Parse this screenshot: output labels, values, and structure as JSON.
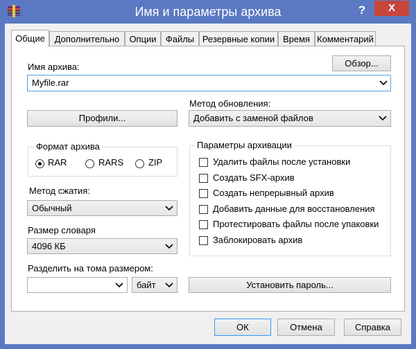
{
  "window": {
    "title": "Имя и параметры архива",
    "help_label": "?",
    "close_label": "X"
  },
  "tabs": [
    {
      "label": "Общие",
      "active": true
    },
    {
      "label": "Дополнительно"
    },
    {
      "label": "Опции"
    },
    {
      "label": "Файлы"
    },
    {
      "label": "Резервные копии"
    },
    {
      "label": "Время"
    },
    {
      "label": "Комментарий"
    }
  ],
  "general": {
    "archive_name_label": "Имя архива:",
    "browse_label": "Обзор...",
    "archive_name_value": "Myfile.rar",
    "profiles_label": "Профили...",
    "update_method_label": "Метод обновления:",
    "update_method_value": "Добавить с заменой файлов",
    "format_group_title": "Формат архива",
    "formats": [
      {
        "label": "RAR",
        "selected": true
      },
      {
        "label": "RARS",
        "selected": false
      },
      {
        "label": "ZIP",
        "selected": false
      }
    ],
    "compression_label": "Метод сжатия:",
    "compression_value": "Обычный",
    "dictionary_label": "Размер словаря",
    "dictionary_value": "4096 КБ",
    "split_label": "Разделить на тома размером:",
    "split_value": "",
    "split_unit": "байт",
    "options_group_title": "Параметры архивации",
    "options": [
      {
        "label": "Удалить файлы после установки",
        "checked": false
      },
      {
        "label": "Создать SFX-архив",
        "checked": false
      },
      {
        "label": "Создать непрерывный архив",
        "checked": false
      },
      {
        "label": "Добавить данные для восстановления",
        "checked": false
      },
      {
        "label": "Протестировать файлы после упаковки",
        "checked": false
      },
      {
        "label": "Заблокировать архив",
        "checked": false
      }
    ],
    "set_password_label": "Установить пароль..."
  },
  "footer": {
    "ok_label": "ОК",
    "cancel_label": "Отмена",
    "help_label": "Справка"
  },
  "colors": {
    "title_bar": "#5a79c2",
    "close_button": "#c7453a",
    "focus_border": "#569de5"
  }
}
